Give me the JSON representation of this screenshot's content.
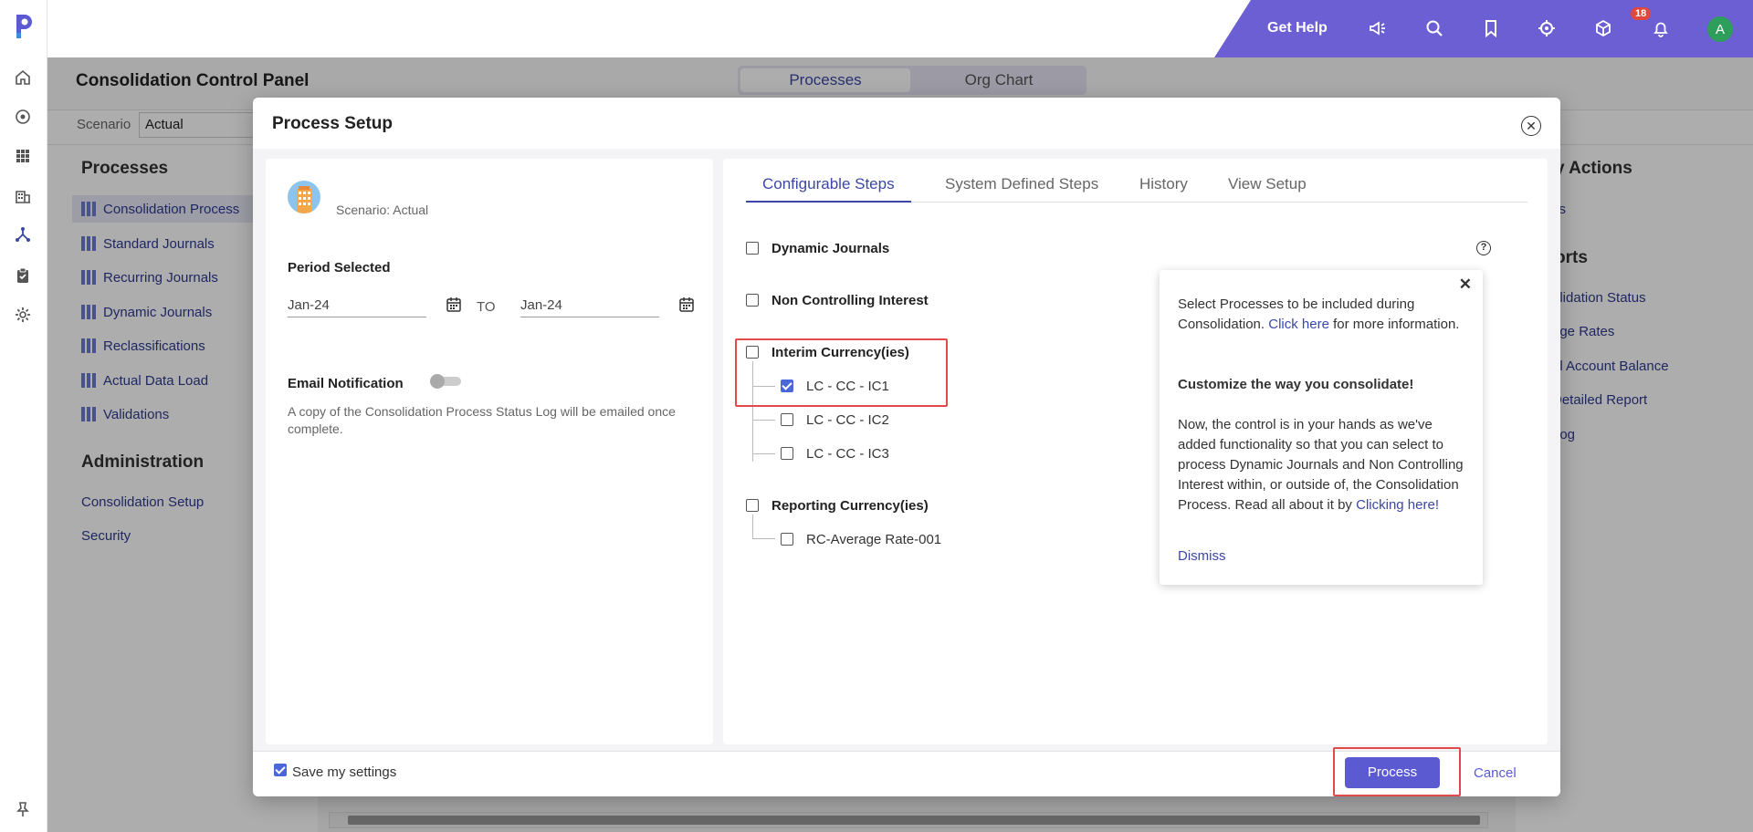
{
  "topbar": {
    "get_help": "Get Help",
    "notification_count": "18",
    "avatar_initial": "A",
    "accent_color": "#6b5fd3"
  },
  "page": {
    "title": "Consolidation Control Panel",
    "segments": [
      "Processes",
      "Org Chart"
    ],
    "scenario_label": "Scenario",
    "scenario_value": "Actual"
  },
  "sidebar": {
    "processes_heading": "Processes",
    "process_items": [
      "Consolidation Process",
      "Standard Journals",
      "Recurring Journals",
      "Dynamic Journals",
      "Reclassifications",
      "Actual Data Load",
      "Validations"
    ],
    "admin_heading": "Administration",
    "admin_items": [
      "Consolidation Setup",
      "Security"
    ]
  },
  "right_panel": {
    "actions_heading": "y Actions",
    "actions_items": [
      "ss"
    ],
    "reports_heading": "orts",
    "reports_items": [
      "olidation Status",
      "nge Rates",
      "al Account Balance",
      "Detailed Report",
      "Log"
    ]
  },
  "modal": {
    "title": "Process Setup",
    "scenario_text": "Scenario: Actual",
    "period_label": "Period Selected",
    "period_from": "Jan-24",
    "to_label": "TO",
    "period_to": "Jan-24",
    "email_label": "Email Notification",
    "email_desc": "A copy of the Consolidation Process Status Log will be emailed once complete.",
    "tabs": [
      "Configurable Steps",
      "System Defined Steps",
      "History",
      "View Setup"
    ],
    "steps": {
      "dynamic_journals": "Dynamic Journals",
      "non_controlling": "Non Controlling Interest",
      "interim_currency": "Interim Currency(ies)",
      "interim_children": [
        "LC - CC - IC1",
        "LC - CC - IC2",
        "LC - CC - IC3"
      ],
      "reporting_currency": "Reporting Currency(ies)",
      "reporting_children": [
        "RC-Average Rate-001"
      ]
    },
    "popover": {
      "intro_pre": "Select Processes to be included during Consolidation. ",
      "intro_link": "Click here",
      "intro_post": " for more information.",
      "heading": "Customize the way you consolidate!",
      "body_pre": "Now, the control is in your hands as we've added functionality so that you can select to process Dynamic Journals and Non Controlling Interest within, or outside of, the Consolidation Process. Read all about it by ",
      "body_link": "Clicking here!",
      "dismiss": "Dismiss"
    },
    "save_settings": "Save my settings",
    "process_button": "Process",
    "cancel_button": "Cancel"
  }
}
